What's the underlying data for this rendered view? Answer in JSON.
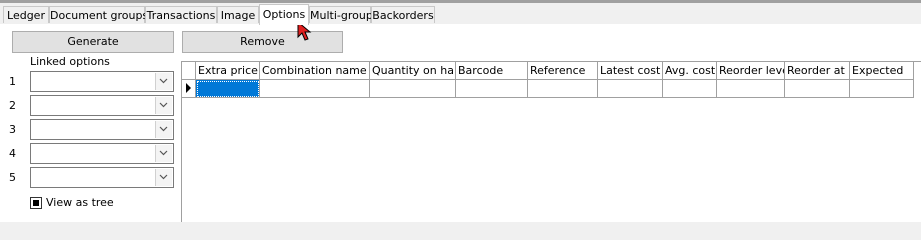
{
  "tabs": [
    {
      "label": "Ledger"
    },
    {
      "label": "Document groups"
    },
    {
      "label": "Transactions"
    },
    {
      "label": "Image"
    },
    {
      "label": "Options"
    },
    {
      "label": "Multi-group"
    },
    {
      "label": "Backorders"
    }
  ],
  "active_tab": "Options",
  "buttons": {
    "generate": "Generate",
    "remove": "Remove"
  },
  "linked_options": {
    "title": "Linked options",
    "rows": [
      {
        "number": "1",
        "value": ""
      },
      {
        "number": "2",
        "value": ""
      },
      {
        "number": "3",
        "value": ""
      },
      {
        "number": "4",
        "value": ""
      },
      {
        "number": "5",
        "value": ""
      }
    ]
  },
  "view_as_tree": {
    "label": "View as tree",
    "checked": true
  },
  "grid": {
    "columns": [
      "Extra price",
      "Combination name",
      "Quantity on hand",
      "Barcode",
      "Reference",
      "Latest cost",
      "Avg. cost",
      "Reorder level",
      "Reorder at",
      "Expected"
    ],
    "rows": [
      [
        "",
        "",
        "",
        "",
        "",
        "",
        "",
        "",
        "",
        ""
      ]
    ]
  },
  "colors": {
    "selection": "#0078d7",
    "cursor": "#e02020"
  }
}
